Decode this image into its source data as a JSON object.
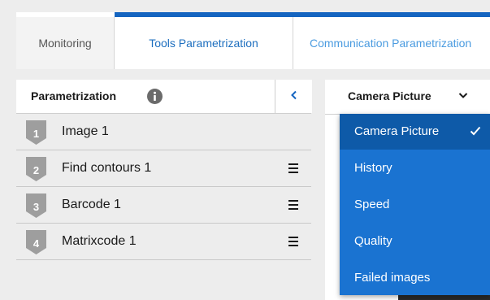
{
  "tabs": [
    {
      "label": "Monitoring"
    },
    {
      "label": "Tools Parametrization"
    },
    {
      "label": "Communication Parametrization"
    }
  ],
  "parametrization_panel": {
    "title": "Parametrization",
    "info_icon": "info-icon",
    "collapse_icon": "chevron-left-icon",
    "tools": [
      {
        "step": "1",
        "label": "Image 1"
      },
      {
        "step": "2",
        "label": "Find contours 1",
        "menu_icon": "hamburger-menu-icon"
      },
      {
        "step": "3",
        "label": "Barcode 1",
        "menu_icon": "hamburger-menu-icon"
      },
      {
        "step": "4",
        "label": "Matrixcode 1",
        "menu_icon": "hamburger-menu-icon"
      }
    ]
  },
  "view_select": {
    "selected": "Camera Picture",
    "chevron_icon": "chevron-down-icon",
    "options": [
      {
        "label": "Camera Picture",
        "selected": true
      },
      {
        "label": "History"
      },
      {
        "label": "Speed"
      },
      {
        "label": "Quality"
      },
      {
        "label": "Failed images"
      }
    ]
  },
  "colors": {
    "accent": "#1565c0",
    "dropdown_bg": "#1a73d1",
    "dropdown_selected": "#0e5aa8",
    "badge_gray": "#9e9e9e",
    "panel_bg": "#ededed"
  }
}
